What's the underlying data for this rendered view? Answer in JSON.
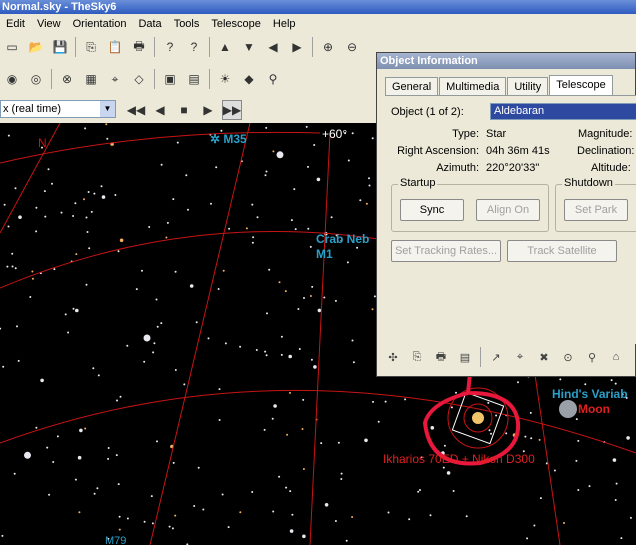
{
  "window": {
    "title": "Normal.sky - TheSky6"
  },
  "menu": {
    "items": [
      "Edit",
      "View",
      "Orientation",
      "Data",
      "Tools",
      "Telescope",
      "Help"
    ]
  },
  "toolbar": {
    "time_combo": "x (real time)",
    "icons1": [
      "new-file-icon",
      "open-folder-icon",
      "save-icon",
      "copy-icon",
      "paste-icon",
      "print-icon",
      "help-icon",
      "context-help-icon",
      "arrow-up-icon",
      "arrow-down-icon",
      "arrow-left-icon",
      "arrow-right-icon",
      "zoom-in-icon",
      "zoom-out-icon"
    ],
    "glyphs1": [
      "▭",
      "📂",
      "💾",
      "⎘",
      "📋",
      "🖶",
      "?",
      "?",
      "▲",
      "▼",
      "◀",
      "▶",
      "⊕",
      "⊖"
    ],
    "icons2": [
      "eye-icon",
      "target-icon",
      "globe-icon",
      "grid-icon",
      "crosshair-icon",
      "shapes-icon",
      "folder-icon",
      "image-icon",
      "sun-icon",
      "telescope-red-icon",
      "binoculars-icon"
    ],
    "glyphs2": [
      "◉",
      "◎",
      "⊗",
      "▦",
      "⌖",
      "◇",
      "▣",
      "▤",
      "☀",
      "◆",
      "⚲"
    ],
    "time_controls": [
      "◀◀",
      "◀",
      "■",
      "▶",
      "▶▶"
    ],
    "time_controls_names": [
      "fast-reverse-icon",
      "step-reverse-icon",
      "stop-icon",
      "step-forward-icon",
      "fast-forward-icon"
    ]
  },
  "sky": {
    "labels": {
      "m35": "✲ M35",
      "crab": "Crab Neb",
      "m1": "M1",
      "n": "N",
      "deg60": "+60°",
      "hind": "Hind's Variab",
      "moon": "Moon",
      "scope": "Ikharios 70ED + Nikon D300",
      "m79": "M79"
    }
  },
  "dialog": {
    "title": "Object Information",
    "tabs": [
      "General",
      "Multimedia",
      "Utility",
      "Telescope"
    ],
    "object_label": "Object (1 of 2):",
    "object_value": "Aldebaran",
    "type_label": "Type:",
    "type_value": "Star",
    "ra_label": "Right Ascension:",
    "ra_value": "04h 36m 41s",
    "az_label": "Azimuth:",
    "az_value": "220°20'33\"",
    "mag_label": "Magnitude:",
    "dec_label": "Declination:",
    "alt_label": "Altitude:",
    "startup_label": "Startup",
    "shutdown_label": "Shutdown",
    "sync_label": "Sync",
    "align_label": "Align On",
    "park_label": "Set Park",
    "tracking_label": "Set Tracking Rates...",
    "satellite_label": "Track Satellite"
  },
  "colors": {
    "grid": "#c81414",
    "label": "#2aa0c8",
    "annotation": "#e8173c",
    "moon_label": "#e02020"
  }
}
